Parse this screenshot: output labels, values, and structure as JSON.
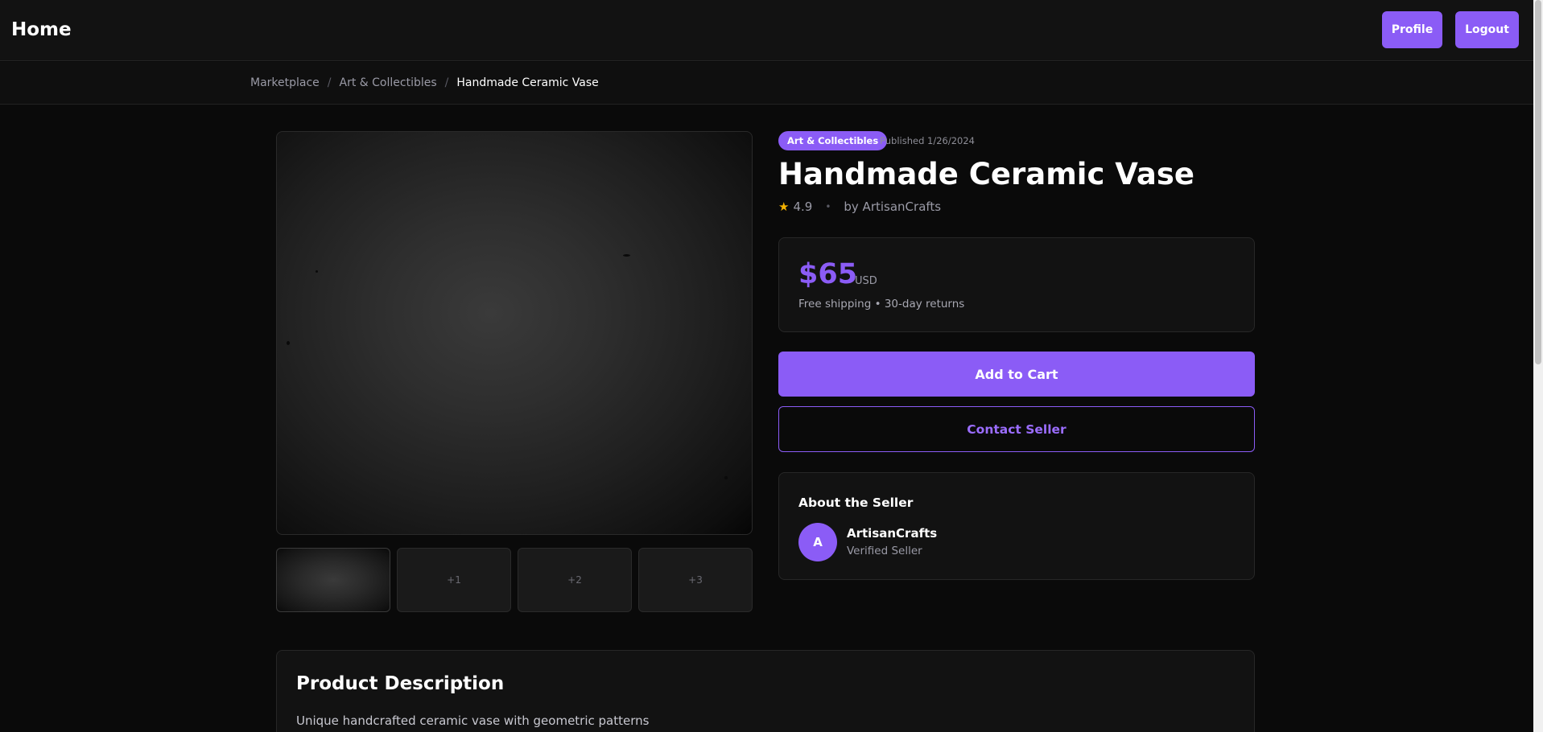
{
  "header": {
    "home_label": "Home",
    "profile_label": "Profile",
    "logout_label": "Logout"
  },
  "breadcrumb": {
    "items": [
      "Marketplace",
      "Art & Collectibles"
    ],
    "separator": "/",
    "current": "Handmade Ceramic Vase"
  },
  "gallery": {
    "thumbnails": [
      "",
      "+1",
      "+2",
      "+3"
    ]
  },
  "product": {
    "category": "Art & Collectibles",
    "published": "Published 1/26/2024",
    "title": "Handmade Ceramic Vase",
    "rating_icon": "★",
    "rating": "4.9",
    "dot": "•",
    "seller_byline": "by ArtisanCrafts"
  },
  "pricing": {
    "price": "$65",
    "currency": "USD",
    "shipping": "Free shipping • 30-day returns"
  },
  "actions": {
    "add_to_cart": "Add to Cart",
    "contact_seller": "Contact Seller"
  },
  "seller": {
    "heading": "About the Seller",
    "initial": "A",
    "name": "ArtisanCrafts",
    "status": "Verified Seller"
  },
  "description": {
    "heading": "Product Description",
    "text": "Unique handcrafted ceramic vase with geometric patterns"
  },
  "colors": {
    "accent": "#8b5cf6",
    "background": "#0a0a0a",
    "card": "#121212",
    "star": "#f5b301"
  }
}
